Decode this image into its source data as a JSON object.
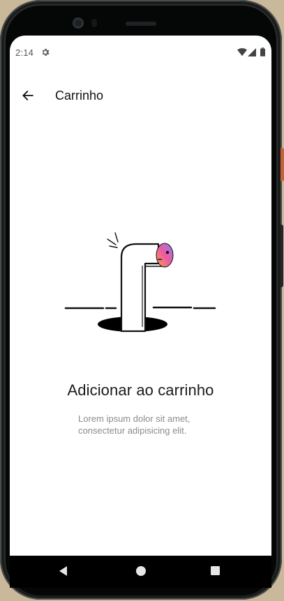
{
  "status_bar": {
    "time": "2:14",
    "icons": [
      "gear-icon",
      "wifi-icon",
      "signal-icon",
      "battery-icon"
    ]
  },
  "app_bar": {
    "back_icon": "arrow-left-icon",
    "title": "Carrinho"
  },
  "empty_state": {
    "illustration": "periscope-pipe-illustration",
    "title": "Adicionar ao carrinho",
    "subtitle": "Lorem ipsum dolor sit amet, consectetur adipisicing elit."
  },
  "nav_bar": {
    "buttons": [
      "back-triangle-icon",
      "home-circle-icon",
      "recents-square-icon"
    ]
  },
  "colors": {
    "screen_bg": "#ffffff",
    "title_text": "#1a1a1a",
    "subtitle_text": "#8b8b8b",
    "nav_bg": "#000000",
    "gradient_start": "#f7a24a",
    "gradient_mid": "#ee5aa0",
    "gradient_end": "#8a7bf0"
  }
}
